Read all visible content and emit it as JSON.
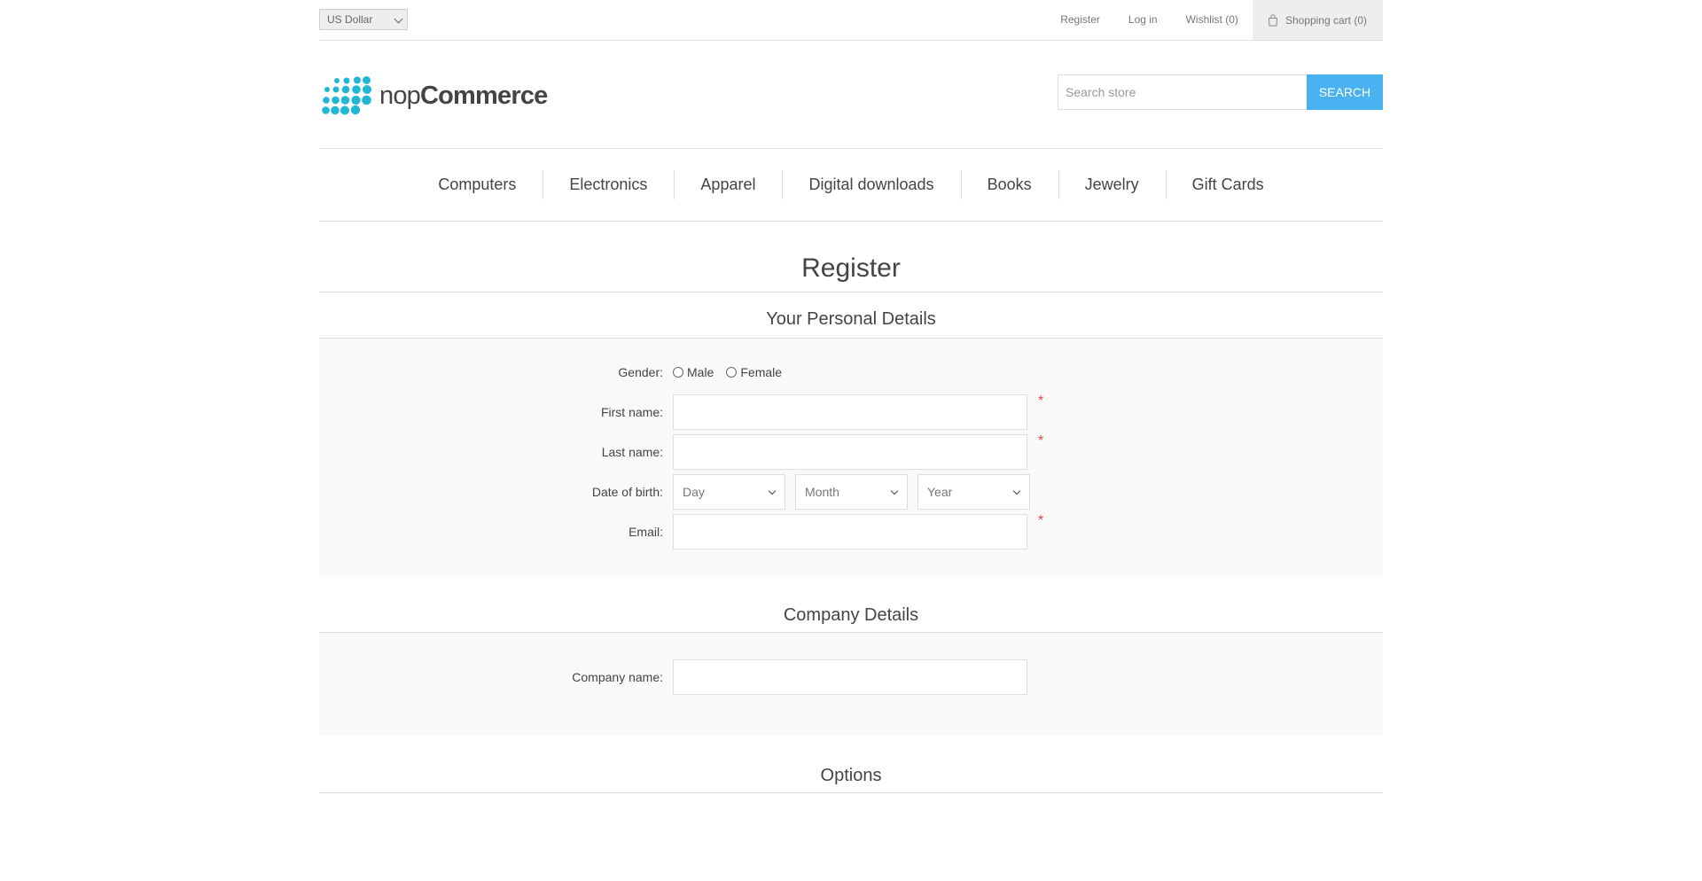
{
  "header": {
    "currency": "US Dollar",
    "links": {
      "register": "Register",
      "login": "Log in",
      "wishlist": "Wishlist (0)",
      "cart": "Shopping cart (0)"
    }
  },
  "logo": {
    "light": "nop",
    "bold": "Commerce"
  },
  "search": {
    "placeholder": "Search store",
    "button": "Search"
  },
  "menu": {
    "items": [
      "Computers",
      "Electronics",
      "Apparel",
      "Digital downloads",
      "Books",
      "Jewelry",
      "Gift Cards"
    ]
  },
  "page": {
    "title": "Register"
  },
  "personal": {
    "title": "Your Personal Details",
    "gender_label": "Gender:",
    "male": "Male",
    "female": "Female",
    "first_name_label": "First name:",
    "last_name_label": "Last name:",
    "dob_label": "Date of birth:",
    "day": "Day",
    "month": "Month",
    "year": "Year",
    "email_label": "Email:",
    "required_mark": "*"
  },
  "company": {
    "title": "Company Details",
    "company_name_label": "Company name:"
  },
  "options": {
    "title": "Options"
  },
  "colors": {
    "accent": "#4ab2f1",
    "logo_blue": "#1fb7d4",
    "required": "#e4444c"
  }
}
